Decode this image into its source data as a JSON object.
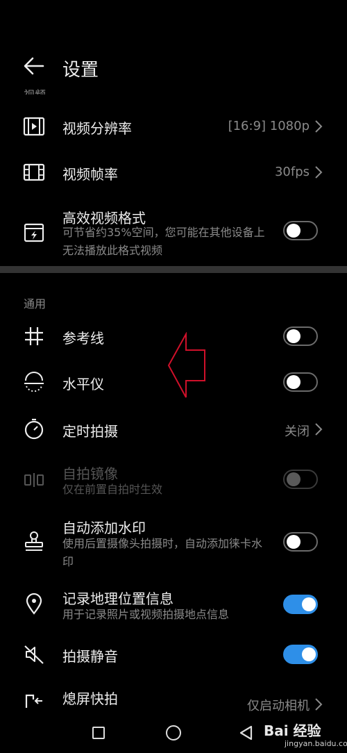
{
  "header": {
    "title": "设置"
  },
  "sections": {
    "video": "视频",
    "general": "通用"
  },
  "rows": {
    "resolution": {
      "label": "视频分辨率",
      "value": "[16:9] 1080p"
    },
    "framerate": {
      "label": "视频帧率",
      "value": "30fps"
    },
    "efficient": {
      "label": "高效视频格式",
      "sub": "可节省约35%空间，您可能在其他设备上无法播放此格式视频",
      "on": false
    },
    "gridlines": {
      "label": "参考线",
      "on": false
    },
    "level": {
      "label": "水平仪",
      "on": false
    },
    "timer": {
      "label": "定时拍摄",
      "value": "关闭"
    },
    "mirror": {
      "label": "自拍镜像",
      "sub": "仅在前置自拍时生效",
      "on": false,
      "enabled": false
    },
    "watermark": {
      "label": "自动添加水印",
      "sub": "使用后置摄像头拍摄时，自动添加徕卡水印",
      "on": false
    },
    "location": {
      "label": "记录地理位置信息",
      "sub": "用于记录照片或视频拍摄地点信息",
      "on": true
    },
    "mute": {
      "label": "拍摄静音",
      "on": true
    },
    "snapshot": {
      "label": "熄屏快拍",
      "value": "仅启动相机"
    }
  },
  "watermark_brand": "Bai 经验",
  "watermark_url": "jingyan.baidu.com",
  "colors": {
    "accent": "#2e8fe8",
    "annotation": "#d0102a"
  }
}
